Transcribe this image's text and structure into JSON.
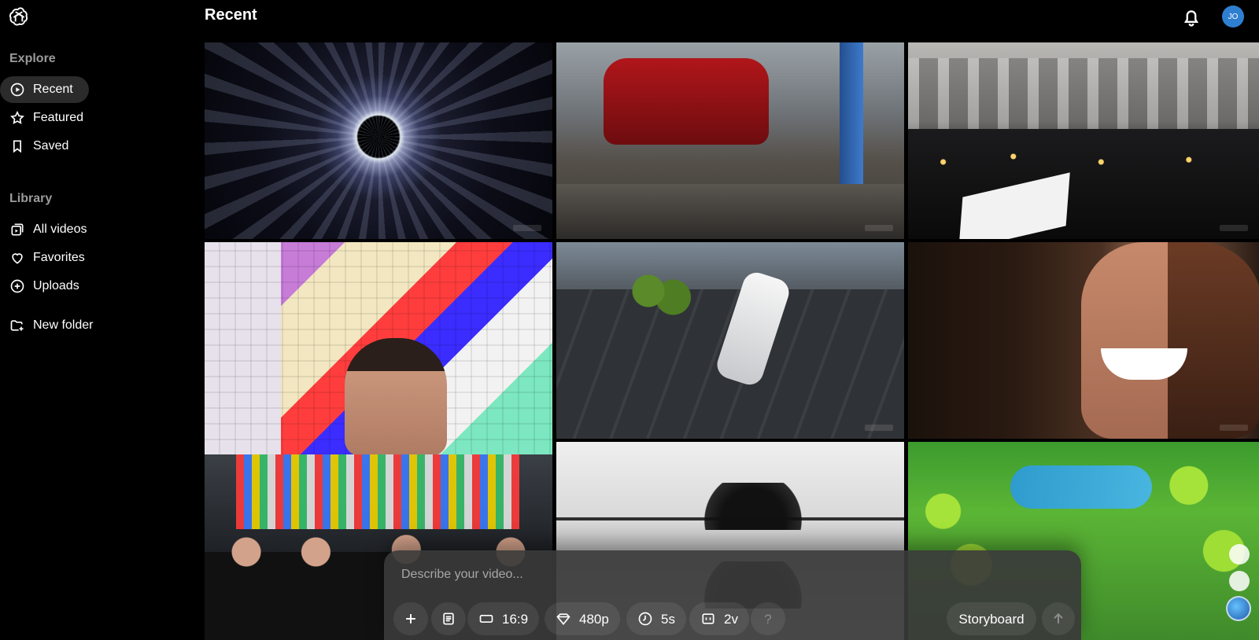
{
  "header": {
    "title": "Recent",
    "avatar_initials": "JO"
  },
  "sidebar": {
    "explore_label": "Explore",
    "library_label": "Library",
    "items": [
      {
        "label": "Recent",
        "icon": "play-circle-icon",
        "active": true
      },
      {
        "label": "Featured",
        "icon": "star-icon",
        "active": false
      },
      {
        "label": "Saved",
        "icon": "bookmark-icon",
        "active": false
      },
      {
        "label": "All videos",
        "icon": "videos-stack-icon",
        "active": false
      },
      {
        "label": "Favorites",
        "icon": "heart-icon",
        "active": false
      },
      {
        "label": "Uploads",
        "icon": "plus-circle-icon",
        "active": false
      },
      {
        "label": "New folder",
        "icon": "folder-plus-icon",
        "active": false
      }
    ]
  },
  "composer": {
    "placeholder": "Describe your video...",
    "aspect_ratio": "16:9",
    "resolution": "480p",
    "duration": "5s",
    "variations": "2v",
    "help_label": "?",
    "storyboard_label": "Storyboard"
  },
  "tiles": [
    {
      "name": "black-hole-swirl"
    },
    {
      "name": "garage-car-repair"
    },
    {
      "name": "protest-crowd-candles"
    },
    {
      "name": "glitch-man-portrait"
    },
    {
      "name": "train-highway-aerial"
    },
    {
      "name": "smiling-woman-closeup"
    },
    {
      "name": "business-meeting"
    },
    {
      "name": "hair-bun-split-frame"
    },
    {
      "name": "cartoon-forest-map"
    }
  ],
  "colors": {
    "background": "#000000",
    "sidebar_active_bg": "#2b2b2b",
    "avatar": "#2f7fd1",
    "composer_bg": "#3a3a3a"
  }
}
